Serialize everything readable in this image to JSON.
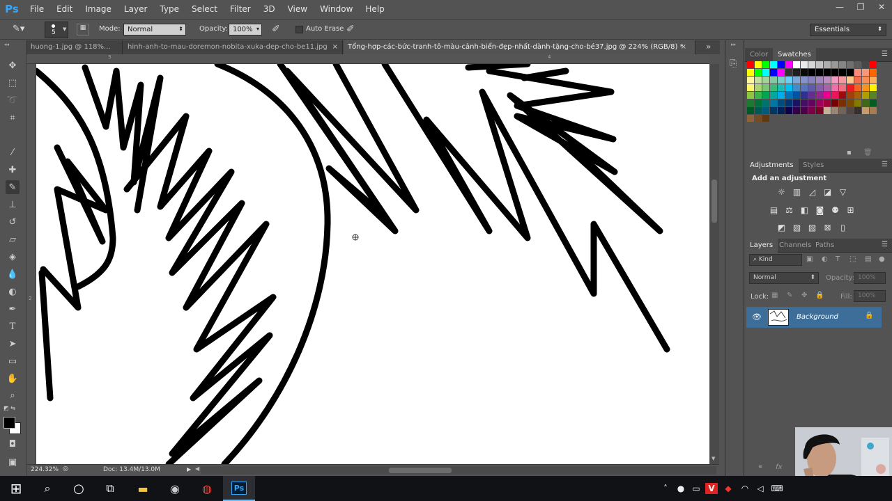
{
  "app": {
    "logo": "Ps"
  },
  "menu": [
    "File",
    "Edit",
    "Image",
    "Layer",
    "Type",
    "Select",
    "Filter",
    "3D",
    "View",
    "Window",
    "Help"
  ],
  "window_controls": {
    "minimize": "—",
    "restore": "❐",
    "close": "✕"
  },
  "options": {
    "brush_size": "5",
    "mode_label": "Mode:",
    "mode_value": "Normal",
    "opacity_label": "Opacity:",
    "opacity_value": "100%",
    "auto_erase_label": "Auto Erase",
    "auto_erase_checked": false,
    "workspace": "Essentials"
  },
  "tabs": [
    {
      "label": "huong-1.jpg @ 118%...",
      "active": false
    },
    {
      "label": "hinh-anh-to-mau-doremon-nobita-xuka-dep-cho-be11.jpg",
      "active": false
    },
    {
      "label": "Tổng-hợp-các-bức-tranh-tô-màu-cảnh-biển-đẹp-nhất-dành-tặng-cho-bé37.jpg @ 224% (RGB/8) *",
      "active": true
    }
  ],
  "tab_close": "×",
  "tab_overflow": "»",
  "rulers": {
    "top": [
      "3",
      "4"
    ],
    "left": [
      "2"
    ]
  },
  "status": {
    "zoom": "224.32%",
    "doc": "Doc: 13.4M/13.0M"
  },
  "panels": {
    "color_tabs": [
      "Color",
      "Swatches"
    ],
    "adjustments_tabs": [
      "Adjustments",
      "Styles"
    ],
    "adjustments_title": "Add an adjustment",
    "layers_tabs": [
      "Layers",
      "Channels",
      "Paths"
    ],
    "kind_label": "Kind",
    "blend_mode": "Normal",
    "opacity_label": "Opacity:",
    "opacity_value": "100%",
    "lock_label": "Lock:",
    "fill_label": "Fill:",
    "fill_value": "100%",
    "layer_name": "Background"
  },
  "colors": {
    "accent": "#31a8ff",
    "panel_bg": "#535353",
    "selected_layer": "#3d6d99",
    "taskbar": "#111216"
  },
  "swatches": [
    "#ff0000",
    "#ffff00",
    "#00ff00",
    "#00ffff",
    "#0000ff",
    "#ff00ff",
    "#ffffff",
    "#ebebeb",
    "#d6d6d6",
    "#c2c2c2",
    "#adadad",
    "#999999",
    "#858585",
    "#707070",
    "#5c5c5c",
    "#474747",
    "#ff0000",
    "#ffff00",
    "#00ff00",
    "#00ffff",
    "#0000ff",
    "#ff00ff",
    "#333333",
    "#1f1f1f",
    "#0a0a0a",
    "#000000",
    "#000000",
    "#000000",
    "#000000",
    "#000000",
    "#000000",
    "#fa8b7a",
    "#f7977a",
    "#ff6600",
    "#fff799",
    "#c4df9b",
    "#a3d39c",
    "#82ca9d",
    "#7bcdc8",
    "#6ecff6",
    "#7ea7d8",
    "#8493ca",
    "#8882be",
    "#a187be",
    "#bc8dbf",
    "#f49ac2",
    "#f6989d",
    "#fdc68a",
    "#f26c4f",
    "#f68e55",
    "#fbaf5c",
    "#fff568",
    "#acd372",
    "#7cc576",
    "#3bb878",
    "#1abbb4",
    "#00bff3",
    "#438cca",
    "#5574b9",
    "#605ca8",
    "#855fa8",
    "#a763a8",
    "#f06ea9",
    "#f26d7d",
    "#ed1c24",
    "#f26522",
    "#f7941d",
    "#fff200",
    "#8dc73f",
    "#39b54a",
    "#00a651",
    "#00a99d",
    "#00aeef",
    "#0072bc",
    "#0054a6",
    "#2e3192",
    "#662d91",
    "#92278f",
    "#ec008c",
    "#ed145b",
    "#9e0b0f",
    "#a0410d",
    "#a3620a",
    "#aba000",
    "#598527",
    "#1a7b30",
    "#007236",
    "#00746b",
    "#0076a3",
    "#004b80",
    "#003471",
    "#1b1464",
    "#440e62",
    "#630460",
    "#9e005d",
    "#9e0039",
    "#790000",
    "#7b2e00",
    "#7d4900",
    "#827b00",
    "#406618",
    "#005e20",
    "#005826",
    "#005952",
    "#005b7f",
    "#003663",
    "#002157",
    "#0d004c",
    "#32004b",
    "#4b0049",
    "#7b0046",
    "#7a0026",
    "#c7b299",
    "#998675",
    "#736357",
    "#534741",
    "#37302a",
    "#c69c6d",
    "#a67c52",
    "#8c6239",
    "#754c24",
    "#603913"
  ],
  "taskbar": {
    "start": "⊞",
    "search": "⌕",
    "cortana": "○",
    "taskview": "⧉",
    "files": "▬",
    "app1": "◉",
    "chrome": "◍",
    "photoshop": "Ps",
    "tray_up": "˄",
    "mic": "●",
    "network": "▭",
    "vpn": "V",
    "security": "◆",
    "wifi": "◠",
    "volume": "◁",
    "keyboard": "⌨"
  }
}
